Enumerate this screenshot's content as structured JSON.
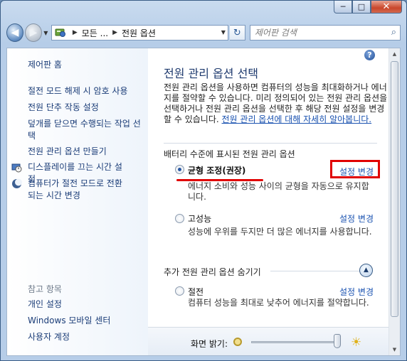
{
  "window": {
    "caption": {
      "minimize": "─",
      "maximize": "□",
      "close": "✕"
    }
  },
  "nav": {
    "back_glyph": "◀",
    "forward_glyph": "▶",
    "address": {
      "crumb1": "모든 ...",
      "crumb2": "전원 옵션"
    },
    "refresh_glyph": "↻",
    "search_placeholder": "제어판 검색"
  },
  "sidebar": {
    "home": "제어판 홈",
    "links": [
      "절전 모드 해제 시 암호 사용",
      "전원 단추 작동 설정",
      "덮개를 닫으면 수행되는 작업 선택",
      "전원 관리 옵션 만들기",
      "디스플레이를 끄는 시간 설정",
      "컴퓨터가 절전 모드로 전환되는 시간 변경"
    ],
    "see_also_head": "참고 항목",
    "see_also": [
      "개인 설정",
      "Windows 모바일 센터",
      "사용자 계정"
    ]
  },
  "main": {
    "title": "전원 관리 옵션 선택",
    "desc": "전원 관리 옵션을 사용하면 컴퓨터의 성능을 최대화하거나 에너지를 절약할 수 있습니다. 미리 정의되어 있는 전원 관리 옵션을 선택하거나 전원 관리 옵션을 선택한 후 해당 전원 설정을 변경할 수 있습니다.",
    "desc_link": "전원 관리 옵션에 대해 자세히 알아봅니다.",
    "battery_group": "배터리 수준에 표시된 전원 관리 옵션",
    "plans": [
      {
        "name": "균형 조정(권장)",
        "desc": "에너지 소비와 성능 사이의 균형을 자동으로 유지합니다.",
        "change": "설정 변경",
        "selected": true
      },
      {
        "name": "고성능",
        "desc": "성능에 우위를 두지만 더 많은 에너지를 사용합니다.",
        "change": "설정 변경",
        "selected": false
      }
    ],
    "extra_group": "추가 전원 관리 옵션 숨기기",
    "extra_plans": [
      {
        "name": "절전",
        "desc": "컴퓨터 성능을 최대로 낮추어 에너지를 절약합니다.",
        "change": "설정 변경",
        "selected": false
      }
    ],
    "brightness_label": "화면 밝기:",
    "brightness_level": 0.97
  },
  "colors": {
    "link": "#1a52b0",
    "annotation": "#e00000",
    "title": "#1e3a6e"
  }
}
